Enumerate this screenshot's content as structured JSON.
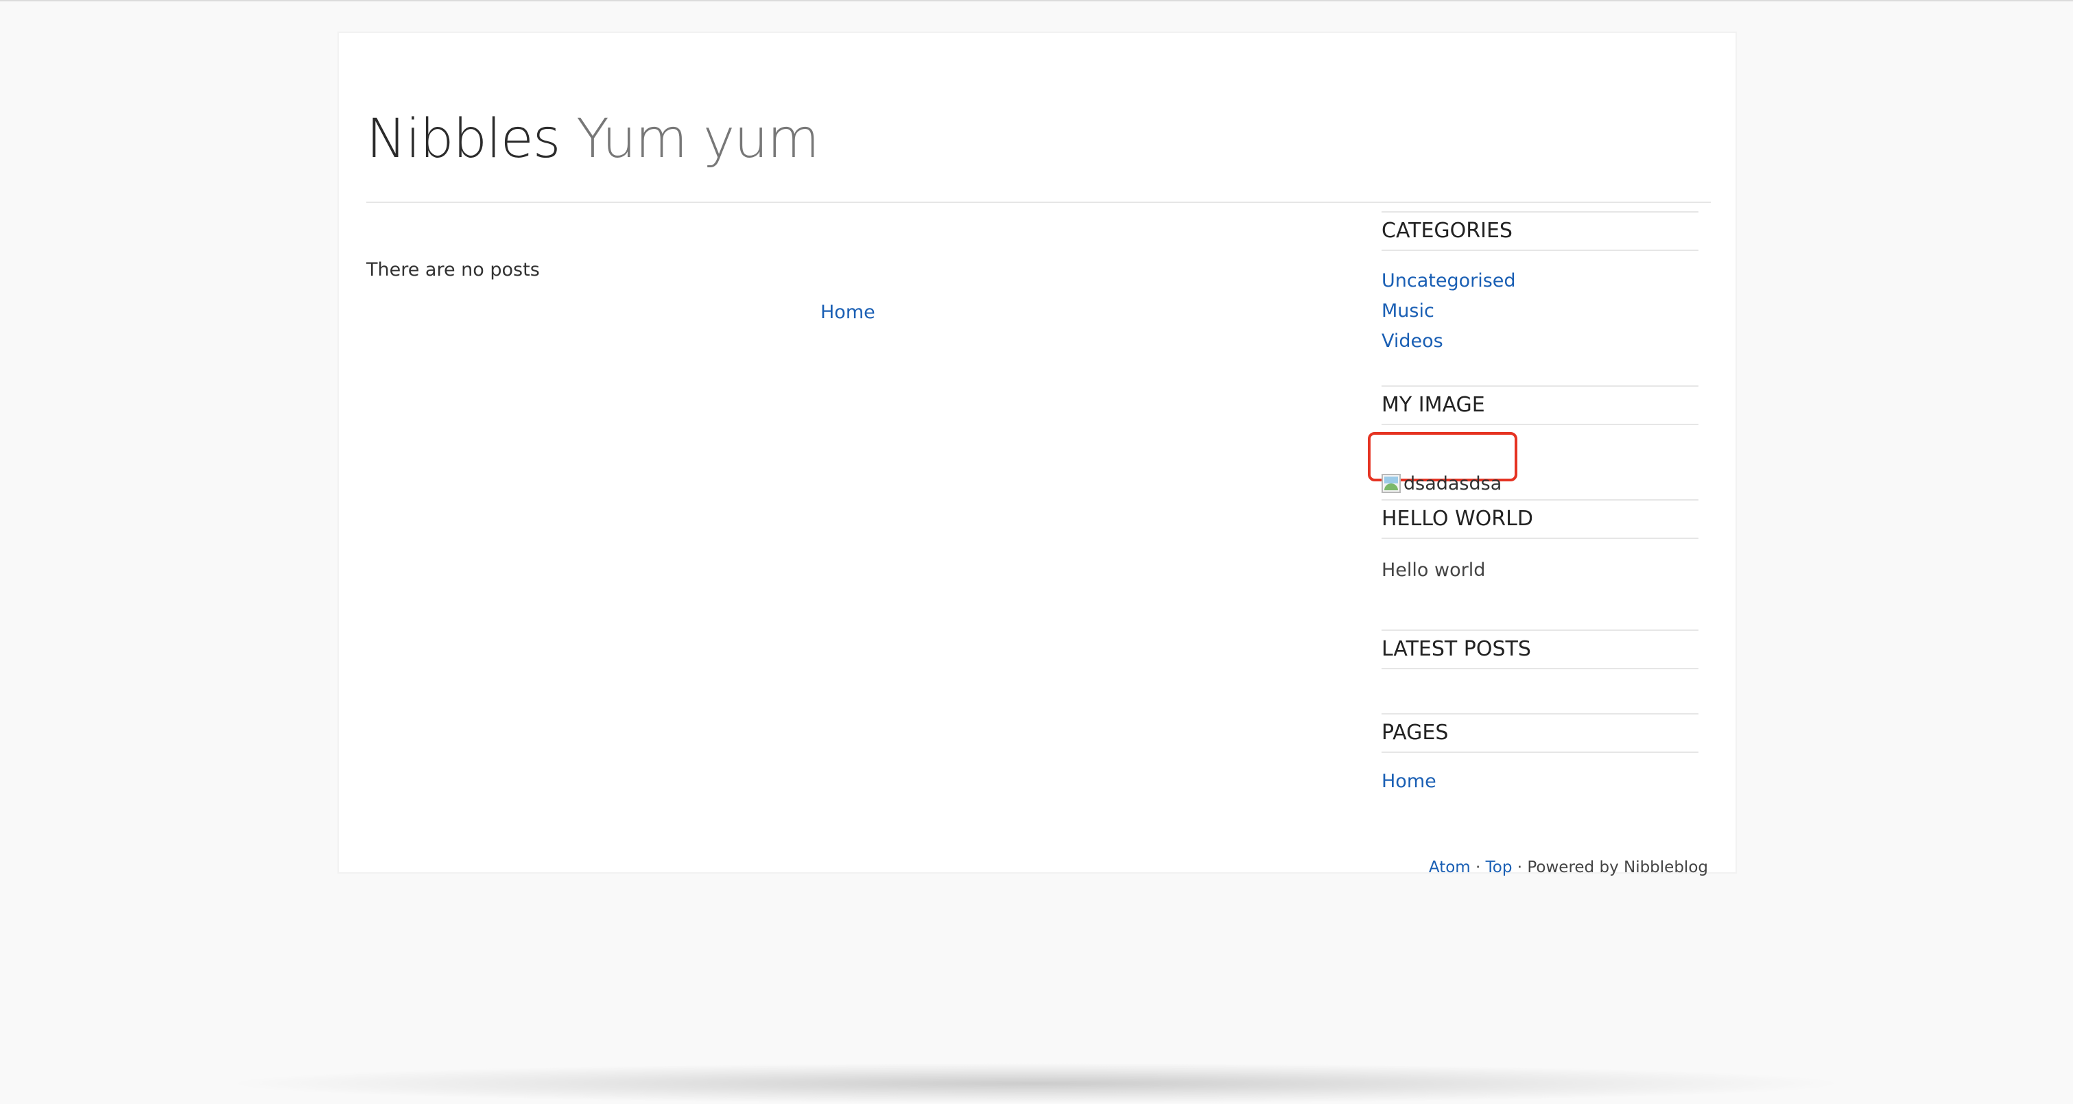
{
  "header": {
    "blog_name": "Nibbles",
    "slogan": "Yum yum"
  },
  "main": {
    "no_posts_text": "There are no posts",
    "pager_home_label": "Home"
  },
  "sidebar": {
    "categories": {
      "title": "CATEGORIES",
      "items": [
        "Uncategorised",
        "Music",
        "Videos"
      ]
    },
    "my_image": {
      "title": "MY IMAGE",
      "alt_text": "dsadasdsa"
    },
    "hello_world": {
      "title": "HELLO WORLD",
      "text": "Hello world"
    },
    "latest_posts": {
      "title": "LATEST POSTS"
    },
    "pages": {
      "title": "PAGES",
      "items": [
        "Home"
      ]
    }
  },
  "footer": {
    "atom_label": "Atom",
    "separator": "·",
    "top_label": "Top",
    "powered_by": "Powered by Nibbleblog"
  },
  "colors": {
    "link": "#1a5fb4",
    "highlight_box": "#e53322"
  }
}
